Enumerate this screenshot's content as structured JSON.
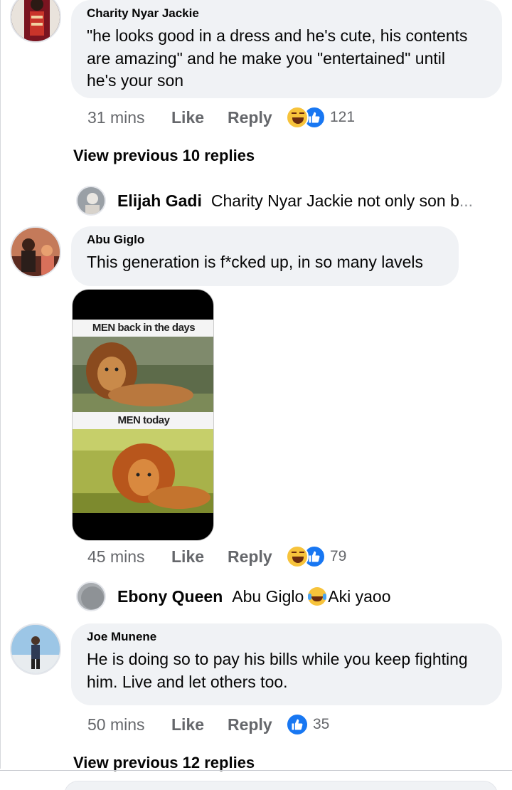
{
  "comments": [
    {
      "author": "Charity Nyar Jackie",
      "text_lines": [
        "\"he looks good in a dress and he's cute, his contents",
        "are amazing\" and he make you \"entertained\" until",
        "he's your son"
      ],
      "time": "31 mins",
      "like_label": "Like",
      "reply_label": "Reply",
      "reaction_count": "121"
    },
    {
      "author": "Abu Giglo",
      "text_lines": [
        "This generation is f*cked up, in so many lavels"
      ],
      "time": "45 mins",
      "like_label": "Like",
      "reply_label": "Reply",
      "reaction_count": "79",
      "meme": {
        "caption_top": "MEN back in the days",
        "caption_bottom": "MEN today"
      }
    },
    {
      "author": "Joe Munene",
      "text_lines": [
        "He is doing so to pay his bills while you keep fighting",
        "him. Live and let others too."
      ],
      "time": "50 mins",
      "like_label": "Like",
      "reply_label": "Reply",
      "reaction_count": "35"
    }
  ],
  "view_previous": [
    "View previous 10 replies",
    "View previous 12 replies"
  ],
  "replies": [
    {
      "author": "Elijah Gadi",
      "text": "Charity Nyar Jackie not only son b",
      "ellipsis": "..."
    },
    {
      "author": "Ebony Queen",
      "text_before": "Abu Giglo",
      "text_after": "Aki yaoo"
    }
  ],
  "colors": {
    "bubble": "#f0f2f5",
    "secondary_text": "#65676b",
    "like_blue": "#1877f2",
    "haha_yellow": "#f7c33b"
  },
  "icons": [
    "haha-reaction-icon",
    "like-reaction-icon",
    "laughing-crying-emoji-icon"
  ]
}
